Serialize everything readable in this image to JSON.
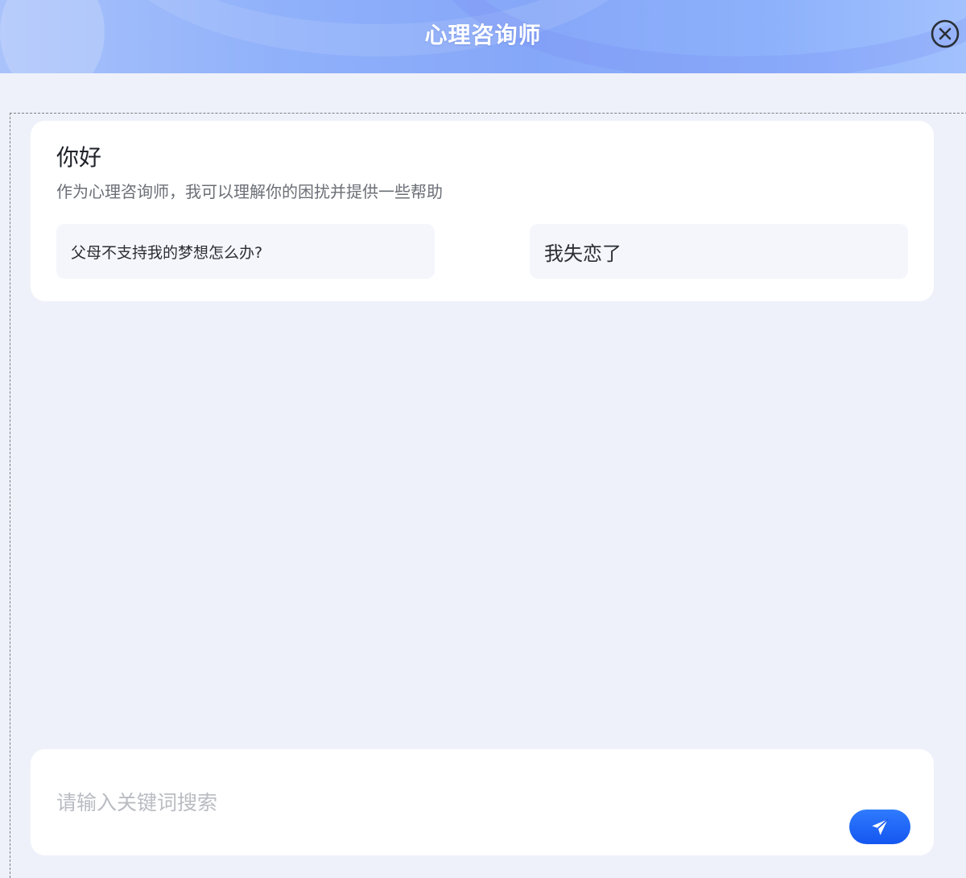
{
  "header": {
    "title": "心理咨询师",
    "close_icon": "close-circle-icon"
  },
  "welcome": {
    "greeting": "你好",
    "intro": "作为心理咨询师，我可以理解你的困扰并提供一些帮助",
    "suggestions": [
      {
        "label": "父母不支持我的梦想怎么办?"
      },
      {
        "label": "我失恋了"
      }
    ]
  },
  "composer": {
    "value": "",
    "placeholder": "请输入关键词搜索",
    "send_icon": "paper-plane-icon"
  },
  "colors": {
    "accent": "#1a5cf5",
    "background": "#eef1f9",
    "card": "#ffffff"
  }
}
